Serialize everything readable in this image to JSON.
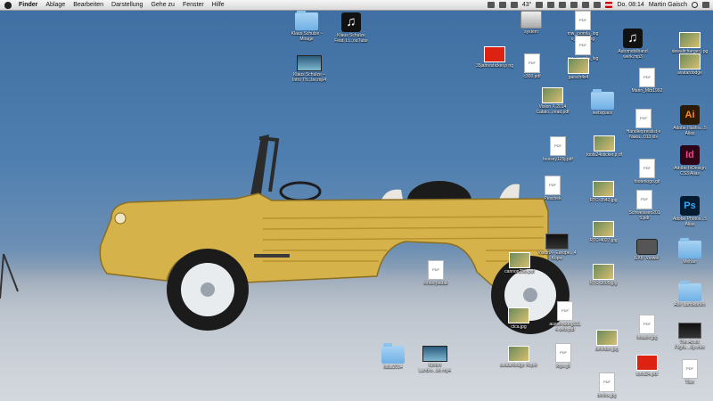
{
  "menubar": {
    "app_name": "Finder",
    "menus": [
      "Ablage",
      "Bearbeiten",
      "Darstellung",
      "Gehe zu",
      "Fenster",
      "Hilfe"
    ],
    "temperature": "43°",
    "clock": "Do. 08:14",
    "user": "Martin Gaisch"
  },
  "desktop_items": [
    {
      "id": "klaus-mirage",
      "label": "Klaus Schulze - Mirage",
      "type": "folder"
    },
    {
      "id": "klaus-youtube",
      "label": "Klaus Schulze Feat. Li...ouTube",
      "type": "music"
    },
    {
      "id": "klaus-mp4",
      "label": "Klaus Schulze – Intro Th...be.mp4",
      "type": "video"
    },
    {
      "id": "system",
      "label": "system",
      "type": "drive"
    },
    {
      "id": "mw-joomla-1",
      "label": "mw_joomla_log o_trans.png",
      "type": "doc"
    },
    {
      "id": "mw-joomla-2",
      "label": "mw_joomla_log o.png",
      "type": "doc"
    },
    {
      "id": "automobilhandwerk",
      "label": "Automobilhand werk.mp3",
      "type": "music"
    },
    {
      "id": "dewaltcharger",
      "label": "dewaltcharger.j pg",
      "type": "photo"
    },
    {
      "id": "35jahresticker",
      "label": "35jahresticker.p ng",
      "type": "sticker"
    },
    {
      "id": "c300",
      "label": "c300.pdf",
      "type": "doc"
    },
    {
      "id": "guisch4x4",
      "label": "guisch4x4",
      "type": "photo"
    },
    {
      "id": "marin-mtb",
      "label": "Marin_Mtb1992",
      "type": "doc"
    },
    {
      "id": "avatardodge",
      "label": "avatardodge",
      "type": "photo"
    },
    {
      "id": "vision-x",
      "label": "Vision X 2014 Catalo...read.pdf",
      "type": "photo"
    },
    {
      "id": "webspace",
      "label": "webspace",
      "type": "folder"
    },
    {
      "id": "haendlerpreisliste",
      "label": "Händlerpreislist e Naka...013.xls",
      "type": "doc"
    },
    {
      "id": "adobe-illustrator",
      "label": "Adobe Illustra...5 Alias",
      "type": "ai"
    },
    {
      "id": "bessey",
      "label": "bessey125j.pdf",
      "type": "doc"
    },
    {
      "id": "tools24sticker",
      "label": "tools24sticker.p df",
      "type": "photo"
    },
    {
      "id": "adobe-indesign",
      "label": "Adobe InDesign CS3 Alias",
      "type": "id"
    },
    {
      "id": "peschek",
      "label": "Peschek",
      "type": "doc"
    },
    {
      "id": "footerlogo",
      "label": "footerlogo.gif",
      "type": "doc"
    },
    {
      "id": "rtc-3542",
      "label": "RTC-3542.jpg",
      "type": "photo"
    },
    {
      "id": "schweissen",
      "label": "Schweissen201 5.pdf",
      "type": "doc"
    },
    {
      "id": "adobe-photoshop",
      "label": "Adobe Photos...5 Alias",
      "type": "ps"
    },
    {
      "id": "rtc-4027",
      "label": "RTC-4027.jpg",
      "type": "photo"
    },
    {
      "id": "vision-x-europe",
      "label": "VisionX- Europe...4 Kopie",
      "type": "dark"
    },
    {
      "id": "exif-viewer",
      "label": "EXIF Viewer",
      "type": "camera"
    },
    {
      "id": "mehari",
      "label": "Mehari",
      "type": "folder"
    },
    {
      "id": "kinderpaedak",
      "label": "kinderpädak",
      "type": "doc"
    },
    {
      "id": "cannon25",
      "label": "cannon25w.pdf",
      "type": "photo"
    },
    {
      "id": "rtc-3605",
      "label": "RTC-3605.jpg",
      "type": "photo"
    },
    {
      "id": "alte-landkarten",
      "label": "Alte Landkarten",
      "type": "folder"
    },
    {
      "id": "ctca",
      "label": "ctca.jpg",
      "type": "photo"
    },
    {
      "id": "aussendung",
      "label": "aussendung011 4.web.pdf",
      "type": "doc"
    },
    {
      "id": "header",
      "label": "header.jpg",
      "type": "doc"
    },
    {
      "id": "definder",
      "label": "definder.jpg",
      "type": "photo"
    },
    {
      "id": "the-art-of-flight",
      "label": "The.Art.of. Flight....0p.mkv",
      "type": "dark"
    },
    {
      "id": "italia2014",
      "label": "italia2014",
      "type": "folder"
    },
    {
      "id": "kiefert",
      "label": "Kiefert Landro...be.mp4",
      "type": "video"
    },
    {
      "id": "avatardodge-kopie",
      "label": "avatardodge Kopie",
      "type": "photo"
    },
    {
      "id": "logo-gif",
      "label": "logo.gif",
      "type": "doc"
    },
    {
      "id": "tools24",
      "label": "tools24.pdf",
      "type": "sticker"
    },
    {
      "id": "tiller",
      "label": "Tiller",
      "type": "doc"
    },
    {
      "id": "deflex",
      "label": "deflex.jpg",
      "type": "doc"
    }
  ],
  "colors": {
    "sky_top": "#3f6fa2",
    "floor": "#c9ced6",
    "car_body": "#d6b24a",
    "menubar": "#e8e8e8"
  }
}
